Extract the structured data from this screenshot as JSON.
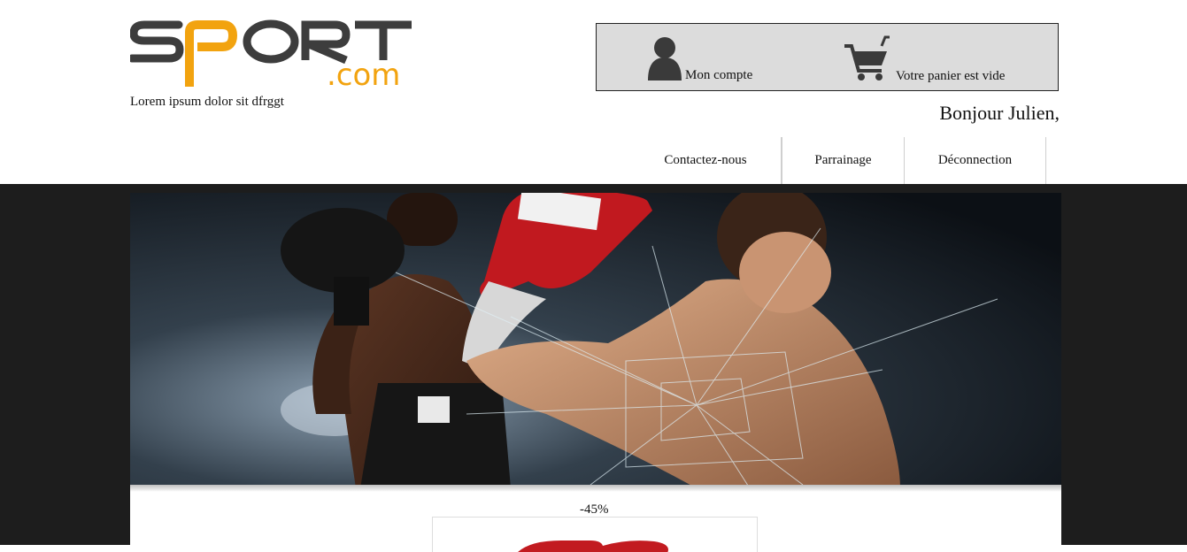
{
  "brand": {
    "logo_main": "SPORT",
    "logo_sub": ".com",
    "tagline": "Lorem ipsum dolor sit dfrggt"
  },
  "account": {
    "account_label": "Mon compte",
    "cart_label": "Votre panier est vide",
    "account_icon": "user-icon",
    "cart_icon": "shopping-cart-icon"
  },
  "greeting": "Bonjour Julien,",
  "nav": {
    "items": [
      {
        "label": "Contactez-nous"
      },
      {
        "label": "Parrainage"
      },
      {
        "label": "Déconnection"
      }
    ]
  },
  "promo": {
    "discount": "-45%"
  },
  "colors": {
    "logo_dark": "#3d3d3d",
    "logo_accent": "#f2a30f",
    "band": "#1d1d1d",
    "account_box": "#dcdcdc"
  }
}
